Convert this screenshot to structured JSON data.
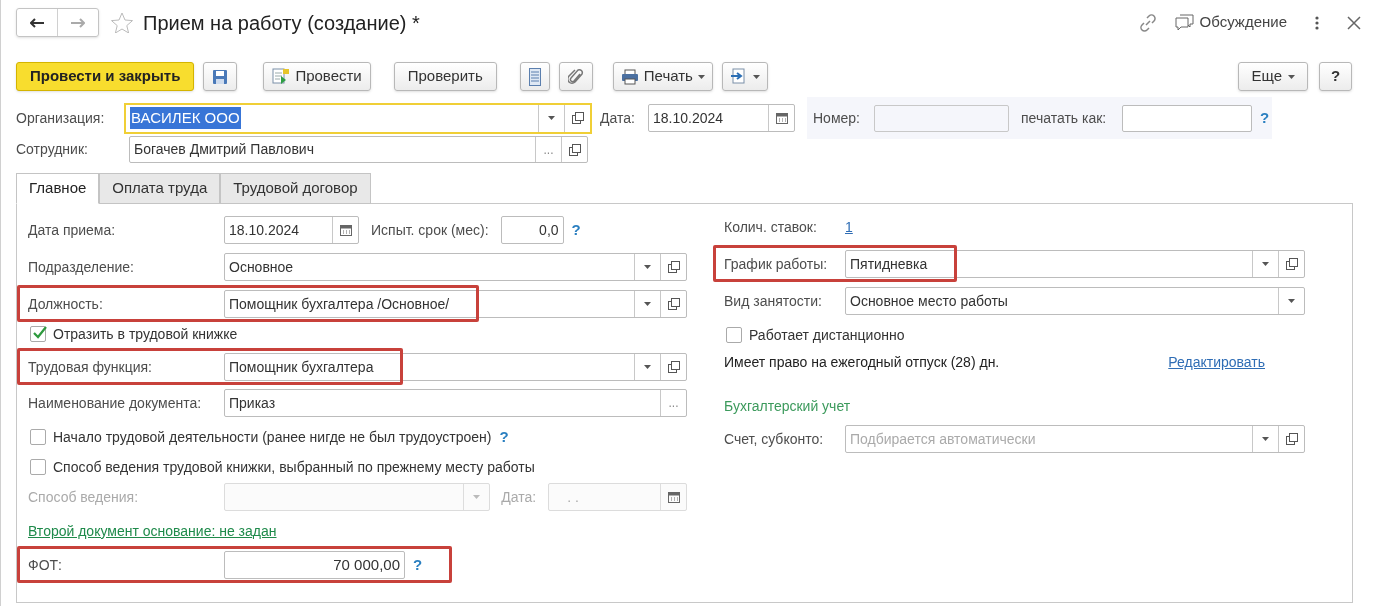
{
  "window": {
    "title": "Прием на работу (создание) *",
    "favorite": false,
    "discussion": "Обсуждение"
  },
  "toolbar": {
    "buttons": [
      {
        "kind": "primary",
        "label": "Провести и закрыть"
      },
      {
        "kind": "save"
      },
      {
        "kind": "post",
        "label": "Провести"
      },
      {
        "kind": "check",
        "label": "Проверить"
      },
      {
        "kind": "list"
      },
      {
        "kind": "attach"
      },
      {
        "kind": "print",
        "label": "Печать"
      },
      {
        "kind": "export"
      }
    ],
    "more": "Еще",
    "help": "?"
  },
  "header": {
    "organization": {
      "label": "Организация:",
      "value": "ВАСИЛЕК ООО",
      "focused": true
    },
    "date": {
      "label": "Дата:",
      "value": "18.10.2024"
    },
    "number": {
      "label": "Номер:"
    },
    "print_as": {
      "label": "печатать как:"
    },
    "help": "?",
    "employee": {
      "label": "Сотрудник:",
      "value": "Богачев Дмитрий Павлович",
      "button": "..."
    }
  },
  "tabs": [
    {
      "label": "Главное",
      "selected": true
    },
    {
      "label": "Оплата труда",
      "selected": false
    },
    {
      "label": "Трудовой договор",
      "selected": false
    }
  ],
  "left": [
    {
      "kind": "date_pair",
      "label": "Дата приема:",
      "value": "18.10.2024",
      "label2": "Испыт. срок (мес):",
      "value2": "0,0",
      "help": "?"
    },
    {
      "kind": "combo",
      "label": "Подразделение:",
      "value": "Основное",
      "open_button": true,
      "highlighted": false
    },
    {
      "kind": "combo",
      "label": "Должность:",
      "value": "Помощник бухгалтера /Основное/",
      "open_button": true,
      "highlighted": true
    },
    {
      "kind": "checkbox",
      "label": "Отразить в трудовой книжке",
      "checked": true
    },
    {
      "kind": "combo",
      "label": "Трудовая функция:",
      "value": "Помощник бухгалтера",
      "open_button": true,
      "highlighted": true
    },
    {
      "kind": "choice",
      "label": "Наименование документа:",
      "value": "Приказ",
      "button": "..."
    },
    {
      "kind": "checkbox",
      "label": "Начало трудовой деятельности (ранее нигде не был трудоустроен)",
      "checked": false,
      "help": "?"
    },
    {
      "kind": "checkbox",
      "label": "Способ ведения трудовой книжки, выбранный по прежнему месту работы",
      "checked": false
    },
    {
      "kind": "combo_date",
      "label": "Способ ведения:",
      "label2": "Дата:",
      "value2": ". .",
      "disabled": true
    },
    {
      "kind": "link",
      "text": "Второй документ основание: не задан"
    },
    {
      "kind": "number",
      "label": "ФОТ:",
      "value": "70 000,00",
      "help": "?",
      "highlighted": true
    }
  ],
  "right": [
    {
      "kind": "stat",
      "label": "Колич. ставок:",
      "value": "1"
    },
    {
      "kind": "combo",
      "label": "График работы:",
      "value": "Пятидневка",
      "open_button": true,
      "highlighted": true
    },
    {
      "kind": "combo",
      "label": "Вид занятости:",
      "value": "Основное место работы",
      "open_button": false,
      "highlighted": false
    },
    {
      "kind": "checkbox",
      "label": "Работает дистанционно",
      "checked": false
    },
    {
      "kind": "text_link",
      "text": "Имеет право на ежегодный отпуск (28) дн.",
      "link": "Редактировать"
    },
    {
      "kind": "section",
      "text": "Бухгалтерский учет"
    },
    {
      "kind": "combo",
      "label": "Счет, субконто:",
      "placeholder": "Подбирается автоматически",
      "open_button": true,
      "highlighted": false
    }
  ]
}
